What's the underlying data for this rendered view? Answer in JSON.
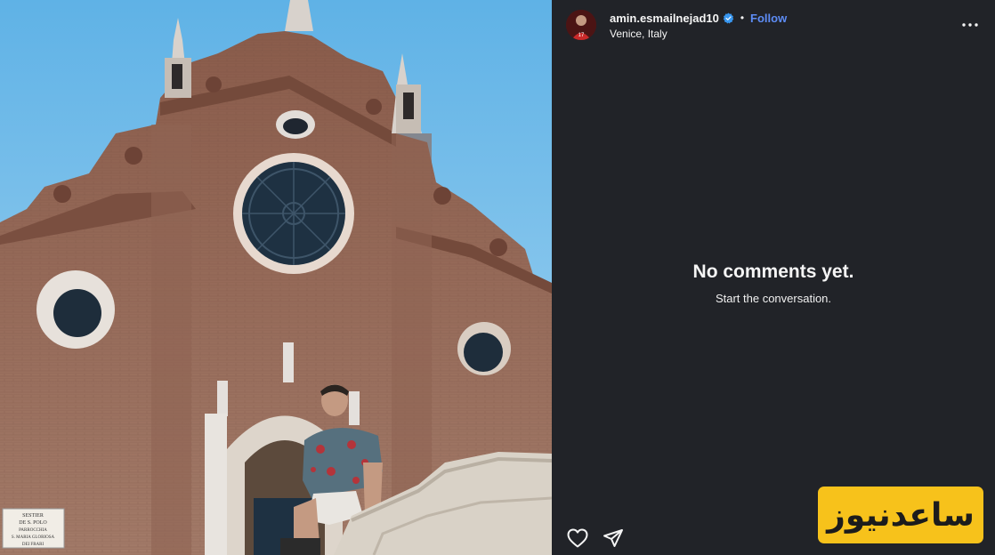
{
  "post": {
    "username": "amin.esmailnejad10",
    "follow_label": "Follow",
    "dot": "•",
    "location": "Venice, Italy",
    "verified": true
  },
  "comments": {
    "empty_title": "No comments yet.",
    "empty_subtitle": "Start the conversation."
  },
  "photo": {
    "plaque_lines": [
      "SESTIER",
      "DE S. POLO",
      "PARROCCHIA",
      "S. MARIA GLORIOSA",
      "DEI FRARI"
    ]
  },
  "actions": {
    "like_icon": "heart-icon",
    "share_icon": "paper-plane-icon"
  },
  "watermark": {
    "text": "ساعدنیوز"
  },
  "colors": {
    "panel_bg": "#212328",
    "follow_blue": "#5d8cf5",
    "verified_blue": "#3897f0",
    "watermark_yellow": "#f7c21b"
  }
}
